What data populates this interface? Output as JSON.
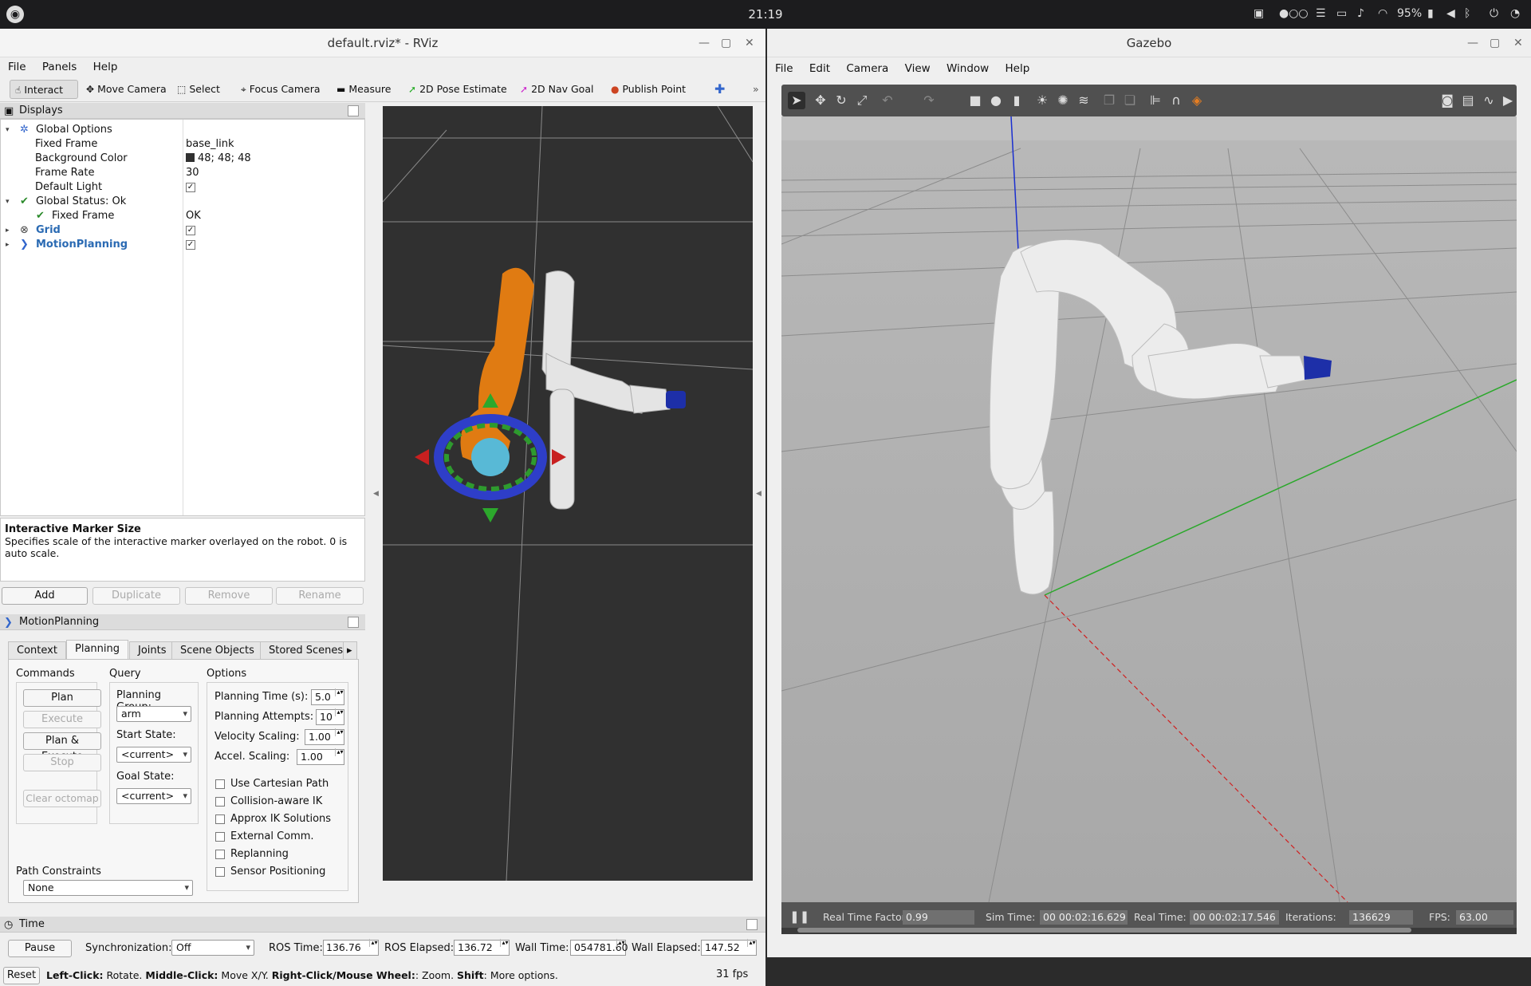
{
  "topbar": {
    "clock": "21:19",
    "battery": "95%"
  },
  "rviz": {
    "title": "default.rviz* - RViz",
    "menu": [
      "File",
      "Panels",
      "Help"
    ],
    "tools": [
      "Interact",
      "Move Camera",
      "Select",
      "Focus Camera",
      "Measure",
      "2D Pose Estimate",
      "2D Nav Goal",
      "Publish Point"
    ],
    "displays_title": "Displays",
    "tree": {
      "global_options": "Global Options",
      "fixed_frame_k": "Fixed Frame",
      "fixed_frame_v": "base_link",
      "bg_color_k": "Background Color",
      "bg_color_v": "48; 48; 48",
      "frame_rate_k": "Frame Rate",
      "frame_rate_v": "30",
      "default_light_k": "Default Light",
      "global_status": "Global Status: Ok",
      "status_fixed_frame_k": "Fixed Frame",
      "status_fixed_frame_v": "OK",
      "grid": "Grid",
      "motion_planning": "MotionPlanning"
    },
    "desc_title": "Interactive Marker Size",
    "desc_text": "Specifies scale of the interactive marker overlayed on the robot. 0 is auto scale.",
    "display_buttons": [
      "Add",
      "Duplicate",
      "Remove",
      "Rename"
    ],
    "mp": {
      "title": "MotionPlanning",
      "tabs": [
        "Context",
        "Planning",
        "Joints",
        "Scene Objects",
        "Stored Scenes"
      ],
      "commands_label": "Commands",
      "query_label": "Query",
      "options_label": "Options",
      "commands": [
        "Plan",
        "Execute",
        "Plan & Execute",
        "Stop",
        "Clear octomap"
      ],
      "planning_group_label": "Planning Group:",
      "planning_group": "arm",
      "start_state_label": "Start State:",
      "start_state": "<current>",
      "goal_state_label": "Goal State:",
      "goal_state": "<current>",
      "planning_time_label": "Planning Time (s):",
      "planning_time": "5.0",
      "planning_attempts_label": "Planning Attempts:",
      "planning_attempts": "10",
      "velocity_label": "Velocity Scaling:",
      "velocity": "1.00",
      "accel_label": "Accel. Scaling:",
      "accel": "1.00",
      "checks": [
        "Use Cartesian Path",
        "Collision-aware IK",
        "Approx IK Solutions",
        "External Comm.",
        "Replanning",
        "Sensor Positioning"
      ],
      "path_constraints_label": "Path Constraints",
      "path_constraints": "None"
    },
    "time": {
      "title": "Time",
      "pause": "Pause",
      "sync_label": "Synchronization:",
      "sync": "Off",
      "ros_time_label": "ROS Time:",
      "ros_time": "136.76",
      "ros_elapsed_label": "ROS Elapsed:",
      "ros_elapsed": "136.72",
      "wall_time_label": "Wall Time:",
      "wall_time": "054781.60",
      "wall_elapsed_label": "Wall Elapsed:",
      "wall_elapsed": "147.52"
    },
    "status": {
      "reset": "Reset",
      "left": "Left-Click:",
      "left_t": "Rotate.",
      "middle": "Middle-Click:",
      "middle_t": "Move X/Y.",
      "right": "Right-Click/Mouse Wheel:",
      "right_t": ": Zoom.",
      "shift": "Shift",
      "shift_t": ": More options.",
      "fps": "31 fps"
    }
  },
  "gazebo": {
    "title": "Gazebo",
    "menu": [
      "File",
      "Edit",
      "Camera",
      "View",
      "Window",
      "Help"
    ],
    "rtf_label": "Real Time Factor:",
    "rtf": "0.99",
    "sim_label": "Sim Time:",
    "sim": "00 00:02:16.629",
    "real_label": "Real Time:",
    "real": "00 00:02:17.546",
    "iter_label": "Iterations:",
    "iter": "136629",
    "fps_label": "FPS:",
    "fps": "63.00"
  },
  "colors": {
    "bg3d": "#303030",
    "orange": "#e07b12",
    "link_blue": "#2a6ab3"
  }
}
